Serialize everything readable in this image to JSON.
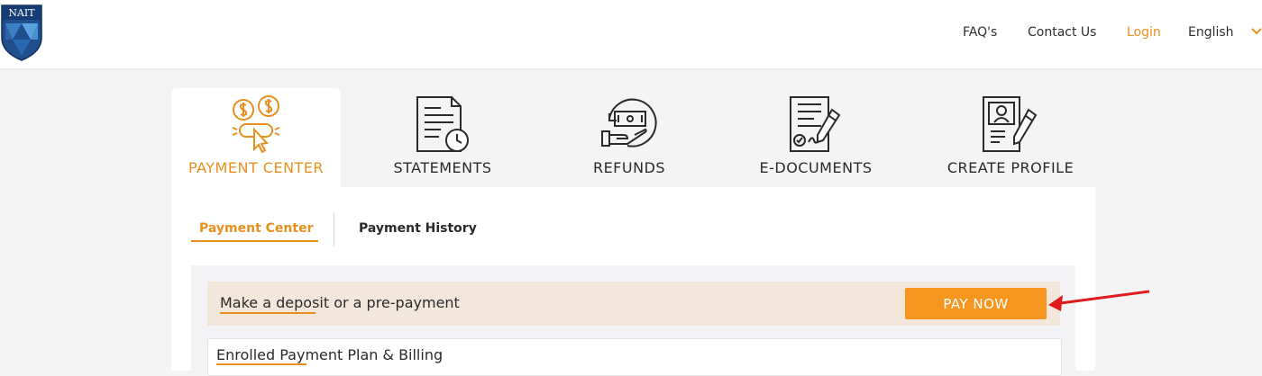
{
  "header": {
    "logo_text": "NAIT",
    "nav": {
      "faqs": "FAQ's",
      "contact": "Contact Us",
      "login": "Login",
      "language": "English"
    }
  },
  "tabs": [
    {
      "label": "PAYMENT CENTER",
      "icon": "payment-center-icon",
      "active": true
    },
    {
      "label": "STATEMENTS",
      "icon": "statements-icon",
      "active": false
    },
    {
      "label": "REFUNDS",
      "icon": "refunds-icon",
      "active": false
    },
    {
      "label": "E-DOCUMENTS",
      "icon": "e-documents-icon",
      "active": false
    },
    {
      "label": "CREATE PROFILE",
      "icon": "create-profile-icon",
      "active": false
    }
  ],
  "subtabs": {
    "payment_center": "Payment Center",
    "payment_history": "Payment History"
  },
  "deposit": {
    "text": "Make a deposit or a pre-payment",
    "button": "PAY NOW"
  },
  "enrolled": {
    "text": "Enrolled Payment Plan & Billing"
  },
  "colors": {
    "accent": "#e8901e",
    "button": "#f7961e",
    "deposit_bg": "#f3e6da",
    "arrow": "#e01b1b",
    "logo_blue": "#1f4e8c"
  }
}
